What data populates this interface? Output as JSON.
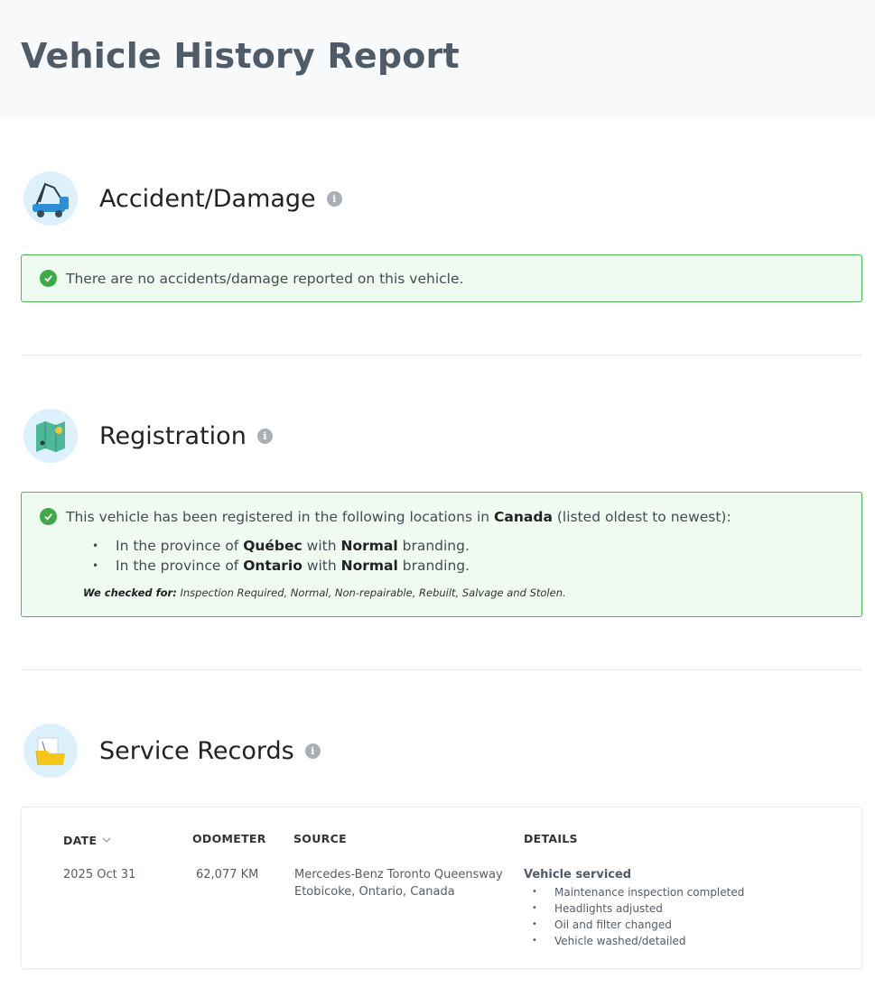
{
  "page": {
    "title": "Vehicle History Report"
  },
  "accident": {
    "title": "Accident/Damage",
    "message": "There are no accidents/damage reported on this vehicle."
  },
  "registration": {
    "title": "Registration",
    "intro_prefix": "This vehicle has been registered in the following locations in ",
    "country": "Canada",
    "intro_suffix": " (listed oldest to newest):",
    "locations": [
      {
        "prefix": "In the province of ",
        "province": "Québec",
        "middle": " with ",
        "branding": "Normal",
        "suffix": " branding."
      },
      {
        "prefix": "In the province of ",
        "province": "Ontario",
        "middle": " with ",
        "branding": "Normal",
        "suffix": " branding."
      }
    ],
    "checked_label": "We checked for:",
    "checked_items": " Inspection Required, Normal, Non-repairable, Rebuilt, Salvage and Stolen."
  },
  "service": {
    "title": "Service Records",
    "columns": {
      "date": "DATE",
      "odometer": "ODOMETER",
      "source": "SOURCE",
      "details": "DETAILS"
    },
    "records": [
      {
        "date": "2025 Oct 31",
        "odometer": "62,077 KM",
        "source_line1": "Mercedes-Benz Toronto Queensway",
        "source_line2": "Etobicoke, Ontario, Canada",
        "detail_title": "Vehicle serviced",
        "details": [
          "Maintenance inspection completed",
          "Headlights adjusted",
          "Oil and filter changed",
          "Vehicle washed/detailed"
        ]
      }
    ]
  },
  "icons": {
    "accident": "tow-truck-icon",
    "registration": "map-icon",
    "service": "folder-icon",
    "info": "info-icon",
    "check": "check-circle-icon",
    "sort": "chevron-down-icon"
  },
  "colors": {
    "success_border": "#4cbb55",
    "success_bg": "#effaf0",
    "check": "#3daa49",
    "heading": "#4f5c67"
  }
}
